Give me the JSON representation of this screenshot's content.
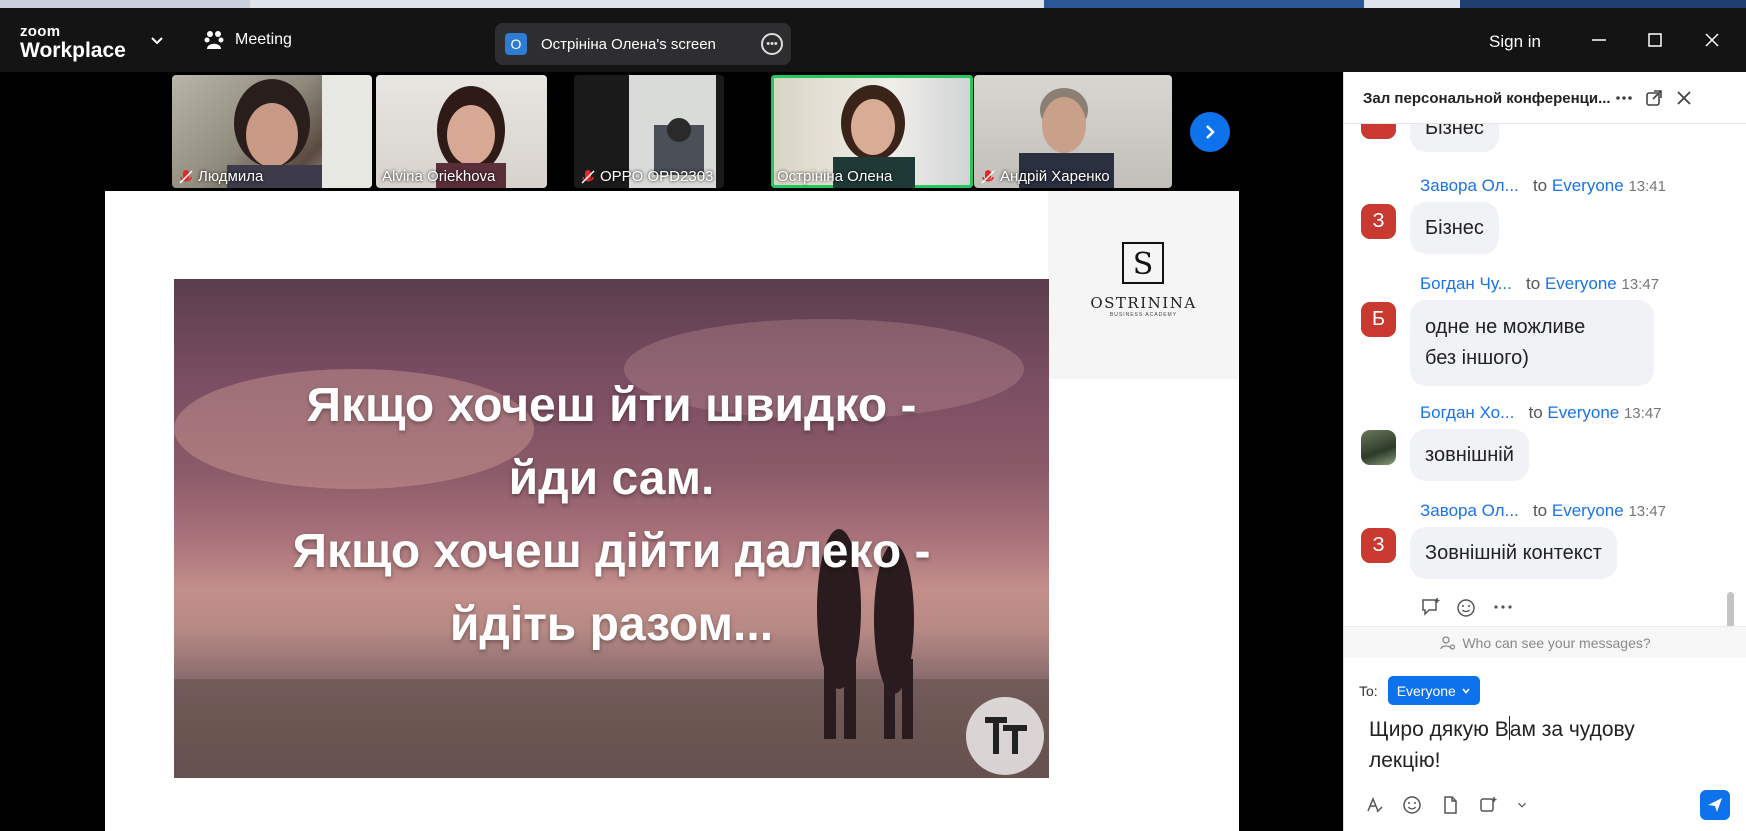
{
  "app": {
    "logo_top": "zoom",
    "logo_bottom": "Workplace"
  },
  "toolbar": {
    "meeting_label": "Meeting",
    "signin_label": "Sign in"
  },
  "share": {
    "badge": "O",
    "label": "Острініна Олена's screen"
  },
  "participants": [
    {
      "name": "Людмила",
      "muted": true
    },
    {
      "name": "Alvina Oriekhova",
      "muted": false
    },
    {
      "name": "OPPO OPD2303",
      "muted": true
    },
    {
      "name": "Острініна Олена",
      "muted": false,
      "active": true
    },
    {
      "name": "Андрій Харенко",
      "muted": true
    }
  ],
  "slide": {
    "quote_lines": [
      "Якщо хочеш йти швидко -",
      "йди сам.",
      "Якщо хочеш дійти далеко -",
      "йдіть разом..."
    ],
    "brand_name": "OSTRININA",
    "brand_sub": "BUSINESS ACADEMY"
  },
  "chat": {
    "title": "Зал персональной конференци...",
    "top_partial_bubble": "Бізнес",
    "messages": [
      {
        "avatar": "З",
        "avatar_color": "#c9392f",
        "sender": "Завора Ол...",
        "to": "to",
        "recipient": "Everyone",
        "time": "13:41",
        "lines": [
          "Бізнес"
        ]
      },
      {
        "avatar": "Б",
        "avatar_color": "#c9392f",
        "sender": "Богдан Чу...",
        "to": "to",
        "recipient": "Everyone",
        "time": "13:47",
        "lines": [
          "одне не можливе",
          "без іншого)"
        ]
      },
      {
        "avatar": "",
        "avatar_color": "#4a5a48",
        "sender": "Богдан Хо...",
        "to": "to",
        "recipient": "Everyone",
        "time": "13:47",
        "lines": [
          "зовнішній"
        ]
      },
      {
        "avatar": "З",
        "avatar_color": "#c9392f",
        "sender": "Завора Ол...",
        "to": "to",
        "recipient": "Everyone",
        "time": "13:47",
        "lines": [
          "Зовнішній контекст"
        ]
      }
    ],
    "privacy_text": "Who can see your messages?",
    "to_label": "To:",
    "recipient_button": "Everyone",
    "compose_before_caret": "Щиро дякую В",
    "compose_after_caret": "ам за чудову лекцію!"
  },
  "colors": {
    "accent": "#0e72ed",
    "active_tile": "#23c75b",
    "avatar_red": "#c9392f"
  }
}
